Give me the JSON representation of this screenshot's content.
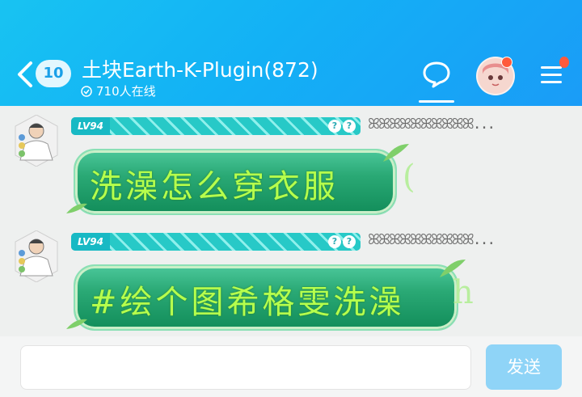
{
  "header": {
    "unread_count": "10",
    "title": "土块Earth-K-Plugin(872)",
    "online": "710人在线",
    "accent": "#18b7f4"
  },
  "messages": [
    {
      "level": "LV94",
      "name": "ꕤꕤꕤꕤꕤꕤꕤꕤꕤꕤ...",
      "text": "洗澡怎么穿衣服",
      "overflow": "("
    },
    {
      "level": "LV94",
      "name": "ꕤꕤꕤꕤꕤꕤꕤꕤꕤꕤ...",
      "text": "#绘个图希格雯洗澡",
      "overflow": "h"
    }
  ],
  "composer": {
    "send_label": "发送",
    "placeholder": ""
  }
}
